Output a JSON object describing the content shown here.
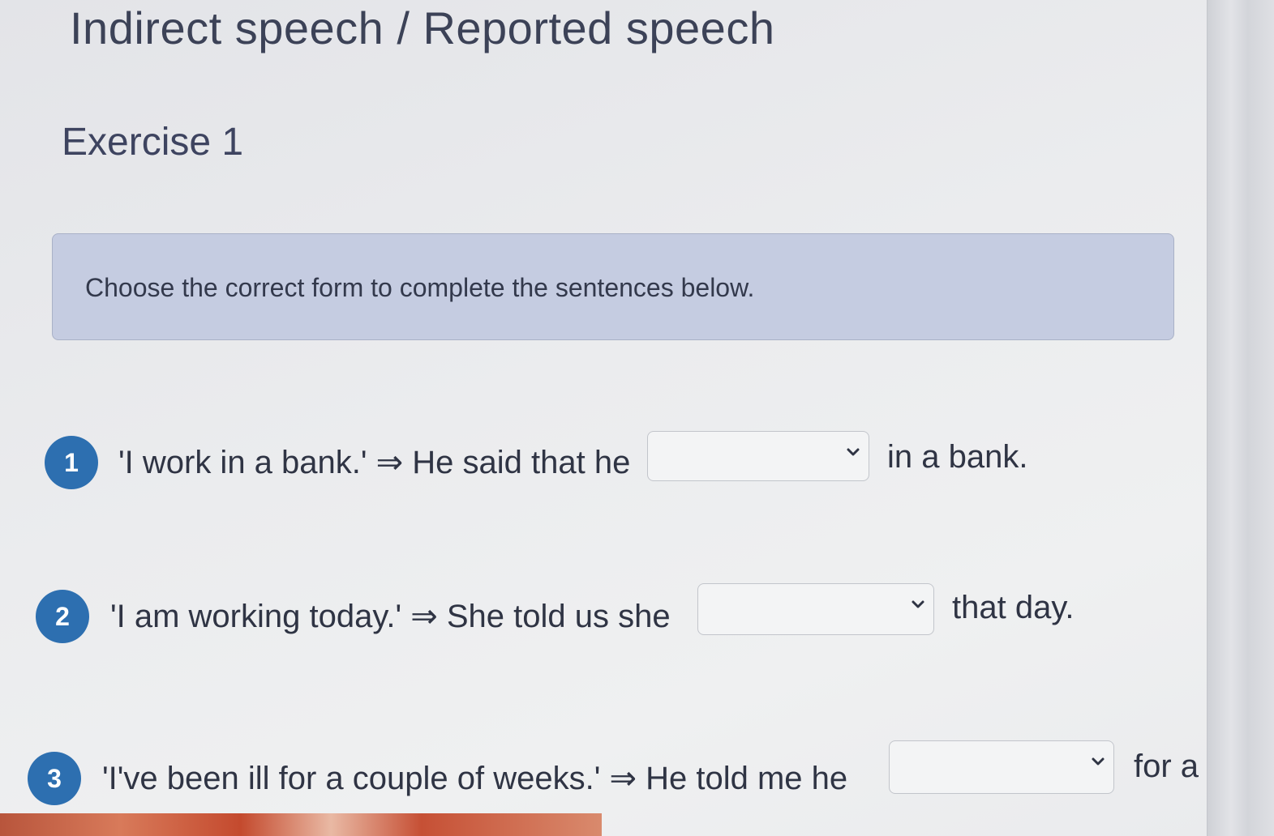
{
  "header": {
    "title": "Indirect speech / Reported speech",
    "subtitle": "Exercise 1"
  },
  "instructions": {
    "text": "Choose the correct form to complete the sentences below."
  },
  "questions": [
    {
      "number": "1",
      "prompt": "'I work in a bank.' ⇒ He said that he",
      "after": "in a bank.",
      "selected": ""
    },
    {
      "number": "2",
      "prompt": "'I am working today.' ⇒ She told us she",
      "after": "that day.",
      "selected": ""
    },
    {
      "number": "3",
      "prompt": "'I've been ill for a couple of weeks.' ⇒ He told me he",
      "after": "for a",
      "selected": ""
    }
  ],
  "icons": {
    "dropdown": "chevron-down-icon"
  },
  "colors": {
    "badge": "#2d6fb0",
    "instructions_bg": "#c5cce1",
    "title": "#3c4257"
  }
}
